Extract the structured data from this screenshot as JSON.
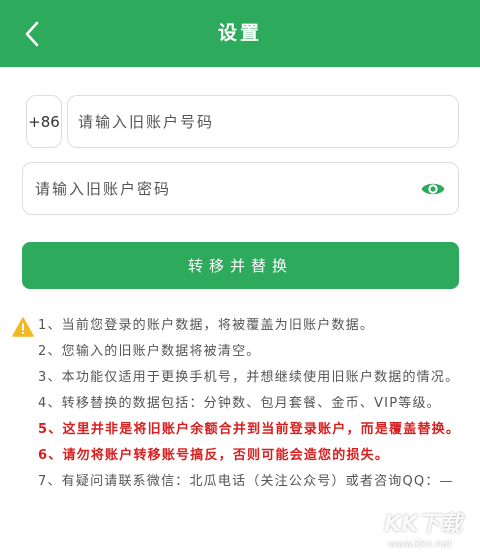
{
  "header": {
    "title": "设置",
    "back_icon": "chevron-left-icon"
  },
  "form": {
    "country_code": "+86",
    "account_placeholder": "请输入旧账户号码",
    "password_placeholder": "请输入旧账户密码",
    "eye_icon": "eye-icon",
    "submit_label": "转移并替换"
  },
  "notes": {
    "warning_icon": "warning-icon",
    "items": [
      "1、当前您登录的账户数据，将被覆盖为旧账户数据。",
      "2、您输入的旧账户数据将被清空。",
      "3、本功能仅适用于更换手机号，并想继续使用旧账户数据的情况。",
      "4、转移替换的数据包括：分钟数、包月套餐、金币、VIP等级。",
      "5、这里并非是将旧账户余额合并到当前登录账户，而是覆盖替换。",
      "6、请勿将账户转移账号搞反，否则可能会造您的损失。",
      "7、有疑问请联系微信：北瓜电话（关注公众号）或者咨询QQ：—"
    ]
  },
  "watermark": {
    "main": "KK下载",
    "sub": "www.kkx.net"
  },
  "colors": {
    "primary": "#2eaa5c",
    "warning_text": "#d81e1e",
    "warning_icon": "#f2b824"
  }
}
